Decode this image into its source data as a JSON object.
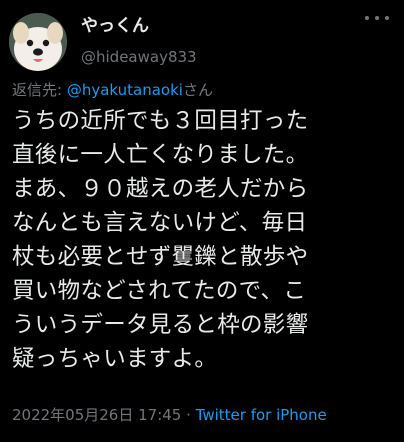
{
  "author": {
    "display_name": "やっくん",
    "handle": "@hideaway833"
  },
  "reply": {
    "prefix": "返信先: ",
    "mention": "@hyakutanaoki",
    "suffix": "さん"
  },
  "tweet": {
    "lines": [
      "うちの近所でも３回目打った",
      "直後に一人亡くなりました。",
      "まあ、９０越えの老人だから",
      "なんとも言えないけど、毎日",
      "杖も必要とせず矍鑠と散歩や",
      "買い物などされてたので、こ",
      "ういうデータ見ると枠の影響",
      "疑っちゃいますよ。"
    ]
  },
  "meta": {
    "timestamp": "2022年05月26日 17:45",
    "separator": " · ",
    "source": "Twitter for iPhone"
  },
  "colors": {
    "background": "#000000",
    "text": "#e7e9ea",
    "muted": "#71767b",
    "link": "#1d9bf0"
  },
  "icons": {
    "more": "more-horizontal-icon",
    "avatar": "dog-avatar"
  }
}
